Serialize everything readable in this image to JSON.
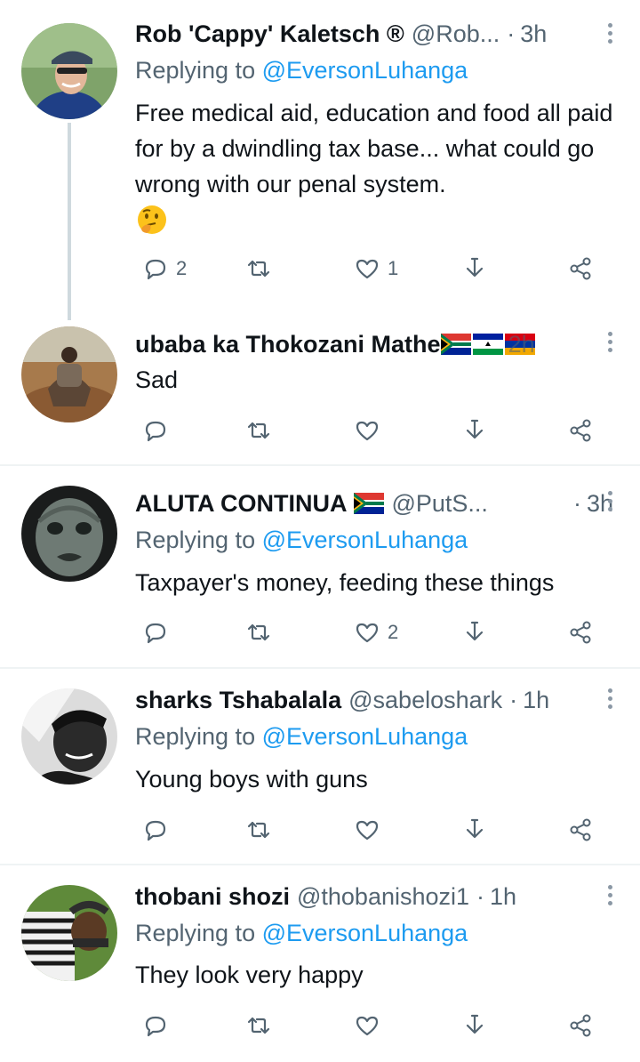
{
  "tweets": [
    {
      "name": "Rob 'Cappy' Kaletsch ®",
      "handle": "@Rob...",
      "dot": "·",
      "time": "3h",
      "replying_prefix": "Replying to ",
      "replying_to": "@EversonLuhanga",
      "text": "Free medical aid, education and food all paid for by a dwindling tax base... what could go wrong with our penal system.",
      "emoji": "thinking-face",
      "reply_count": "2",
      "retweet_count": "",
      "like_count": "1"
    },
    {
      "name": "ubaba ka Thokozani Mathe",
      "flags": [
        "south-africa",
        "lesotho",
        "armenia"
      ],
      "time": "2h",
      "text": "Sad",
      "reply_count": "",
      "retweet_count": "",
      "like_count": ""
    },
    {
      "name": "ALUTA CONTINUA",
      "flags": [
        "south-africa"
      ],
      "handle": "@PutS...",
      "dot": "·",
      "time": "3h",
      "replying_prefix": "Replying to ",
      "replying_to": "@EversonLuhanga",
      "text": "Taxpayer's money, feeding these things",
      "reply_count": "",
      "retweet_count": "",
      "like_count": "2"
    },
    {
      "name": "sharks Tshabalala",
      "handle": "@sabeloshark",
      "dot": "·",
      "time": "1h",
      "replying_prefix": "Replying to ",
      "replying_to": "@EversonLuhanga",
      "text": "Young boys with guns",
      "reply_count": "",
      "retweet_count": "",
      "like_count": ""
    },
    {
      "name": "thobani shozi",
      "handle": "@thobanishozi1",
      "dot": "·",
      "time": "1h",
      "replying_prefix": "Replying to ",
      "replying_to": "@EversonLuhanga",
      "text": "They look very happy",
      "reply_count": "",
      "retweet_count": "",
      "like_count": ""
    }
  ],
  "icons": {
    "reply": "reply-icon",
    "retweet": "retweet-icon",
    "like": "like-icon",
    "download": "download-icon",
    "share": "share-icon",
    "more": "more-icon"
  },
  "colors": {
    "text": "#0f1419",
    "secondary": "#536471",
    "mention": "#1d9bf0",
    "divider": "#eff3f4",
    "thread_line": "#cfd9de"
  }
}
